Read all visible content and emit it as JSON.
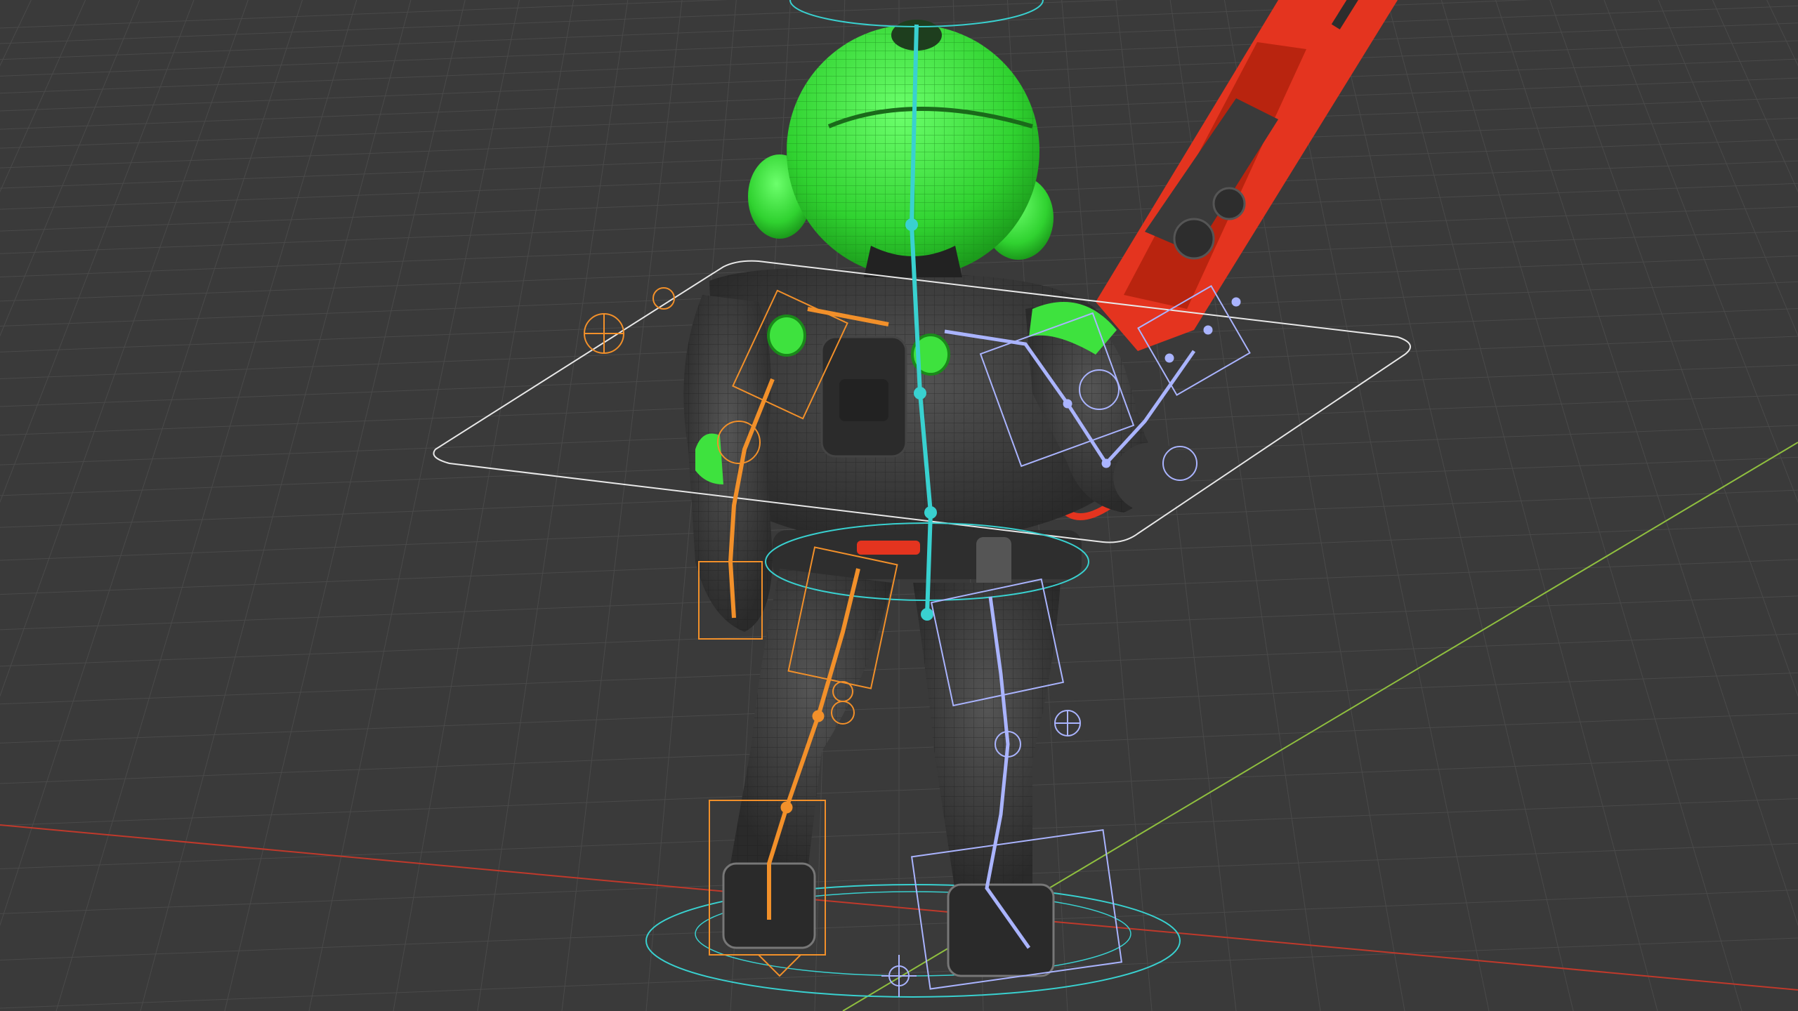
{
  "viewport": {
    "kind": "3d-viewport",
    "background_color": "#3a3a3a",
    "grid_color": "#4a4a4a",
    "x_axis_color": "#c0392b",
    "y_axis_color": "#8fbf3f"
  },
  "model": {
    "helmet_color": "#3ee23e",
    "body_color": "#3c3c3c",
    "weapon_color": "#e4341f",
    "visible_text": []
  },
  "rig": {
    "left_side_color": "#f2902a",
    "right_side_color": "#aab4ff",
    "spine_color": "#39d1d0",
    "control_outline_color": "#e8e8e8"
  }
}
